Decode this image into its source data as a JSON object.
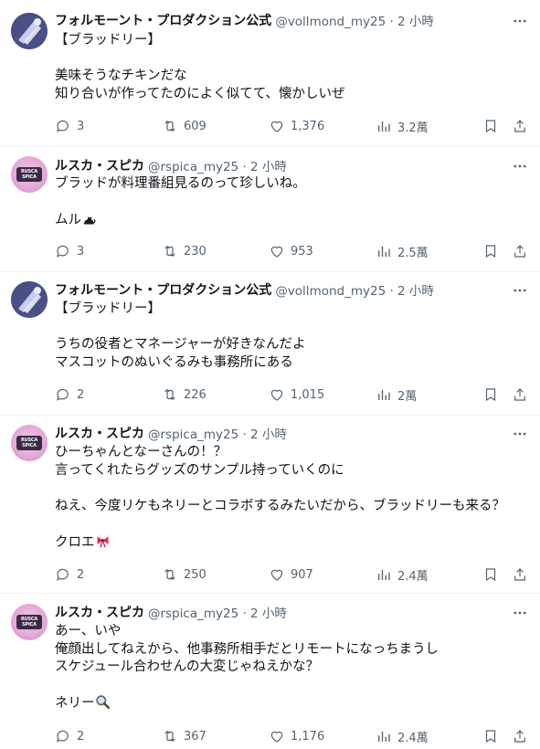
{
  "tweets": [
    {
      "name": "フォルモーント・プロダクション公式",
      "meta": "@vollmond_my25 · 2 小時",
      "text": "【ブラッドリー】\n\n美味そうなチキンだな\n知り合いが作ってたのによく似てて、懐かしいぜ",
      "reply_count": "3",
      "retweet_count": "609",
      "like_count": "1,376",
      "view_count": "3.2萬"
    },
    {
      "name": "ルスカ・スピカ",
      "meta": "@rspica_my25 · 2 小時",
      "text": "ブラッドが料理番組見るのって珍しいね。\n\nムル",
      "reply_count": "3",
      "retweet_count": "230",
      "like_count": "953",
      "view_count": "2.5萬"
    },
    {
      "name": "フォルモーント・プロダクション公式",
      "meta": "@vollmond_my25 · 2 小時",
      "text": "【ブラッドリー】\n\nうちの役者とマネージャーが好きなんだよ\nマスコットのぬいぐるみも事務所にある",
      "reply_count": "2",
      "retweet_count": "226",
      "like_count": "1,015",
      "view_count": "2萬"
    },
    {
      "name": "ルスカ・スピカ",
      "meta": "@rspica_my25 · 2 小時",
      "text": "ひーちゃんとなーさんの！？\n言ってくれたらグッズのサンプル持っていくのに\n\nねえ、今度リケもネリーとコラボするみたいだから、ブラッドリーも来る？\n\nクロエ",
      "reply_count": "2",
      "retweet_count": "250",
      "like_count": "907",
      "view_count": "2.4萬"
    },
    {
      "name": "ルスカ・スピカ",
      "meta": "@rspica_my25 · 2 小時",
      "text": "あー、いや\n俺顔出してねえから、他事務所相手だとリモートになっちまうし\nスケジュール合わせんの大変じゃねえかな？\n\nネリー",
      "reply_count": "2",
      "retweet_count": "367",
      "like_count": "1,176",
      "view_count": "2.4萬"
    }
  ],
  "avatar_text": "RUSCA SPICA",
  "colors": {
    "text": "#0f1419",
    "secondary": "#536471",
    "divider": "#eff3f4"
  }
}
